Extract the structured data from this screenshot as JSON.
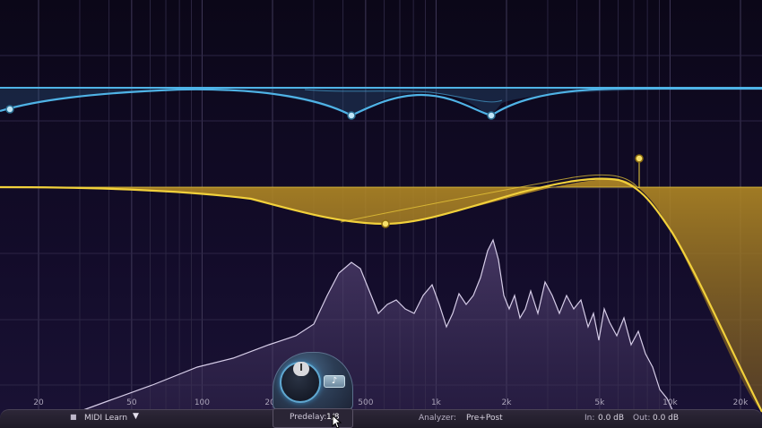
{
  "freq_axis": {
    "labels": [
      {
        "text": "20",
        "hz": 20
      },
      {
        "text": "50",
        "hz": 50
      },
      {
        "text": "100",
        "hz": 100
      },
      {
        "text": "200",
        "hz": 200
      },
      {
        "text": "500",
        "hz": 500
      },
      {
        "text": "1k",
        "hz": 1000
      },
      {
        "text": "2k",
        "hz": 2000
      },
      {
        "text": "5k",
        "hz": 5000
      },
      {
        "text": "10k",
        "hz": 10000
      },
      {
        "text": "20k",
        "hz": 20000
      }
    ]
  },
  "colors": {
    "background": "#0d0820",
    "blue_curve": "#4fb3e6",
    "yellow_curve": "#f2d13b",
    "spectrum": "#cdbfe0",
    "grid": "#3a3352"
  },
  "bottom_bar": {
    "midi_label": "MIDI Learn",
    "predelay_label": "Predelay:",
    "predelay_value": "1/8",
    "analyzer_label": "Analyzer:",
    "analyzer_value": "Pre+Post",
    "in_label": "In:",
    "in_value": "0.0 dB",
    "out_label": "Out:",
    "out_value": "0.0 dB"
  },
  "icons": {
    "sync": "♪"
  }
}
